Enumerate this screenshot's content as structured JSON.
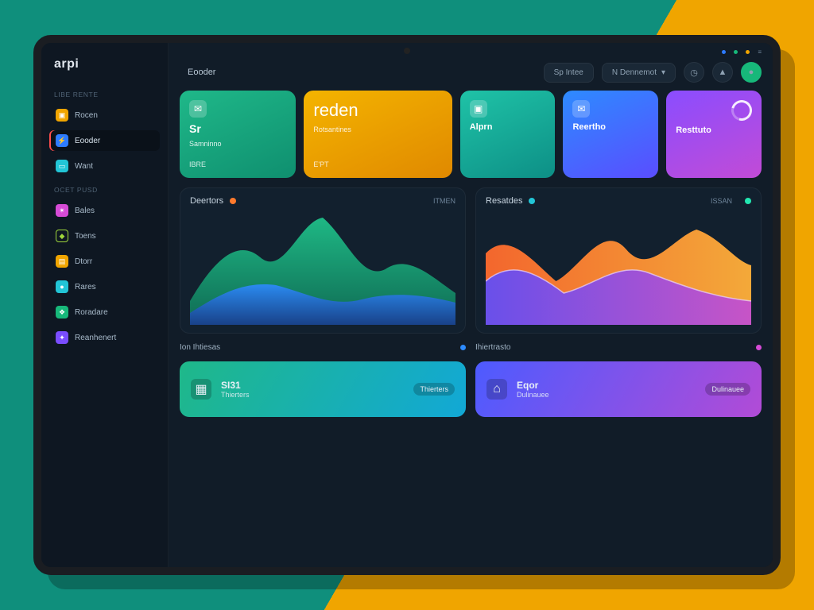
{
  "app": {
    "logo": "arpi"
  },
  "sidebar": {
    "groups": [
      {
        "label": "LIBE RENTE",
        "items": [
          {
            "label": "Rocen"
          },
          {
            "label": "Eooder",
            "active": true
          },
          {
            "label": "Want"
          }
        ]
      },
      {
        "label": "OCET  PUSD",
        "items": [
          {
            "label": "Bales"
          },
          {
            "label": "Toens"
          },
          {
            "label": "Dtorr"
          },
          {
            "label": "Rares"
          },
          {
            "label": "Roradare"
          },
          {
            "label": "Reanhenert"
          }
        ]
      }
    ]
  },
  "header": {
    "breadcrumb": "Eooder",
    "selector1": "Sp  Intee",
    "selector2": "N Dennemot",
    "status_dots": [
      "·",
      "·",
      "·"
    ]
  },
  "cards": [
    {
      "icon": "✉",
      "title": "Sr",
      "sub": "Samninno",
      "foot": "IBRE"
    },
    {
      "icon": "",
      "title": "reden",
      "sub": "Rotsantines",
      "foot": "E'PT"
    },
    {
      "icon": "📷",
      "title": "Alprn",
      "sub": "",
      "foot": ""
    },
    {
      "icon": "✉",
      "title": "Reertho",
      "sub": "",
      "foot": ""
    },
    {
      "icon": "◯",
      "title": "Resttuto",
      "sub": "",
      "foot": ""
    }
  ],
  "charts_meta": {
    "left": {
      "title": "Deertors",
      "sub": "ITMEN",
      "dot": "#ff7a2d"
    },
    "right": {
      "title": "Resatdes",
      "sub": "ISSAN",
      "dot": "#22c5d6"
    }
  },
  "chart_data": [
    {
      "type": "area",
      "title": "Deertors",
      "x": [
        0,
        1,
        2,
        3,
        4,
        5,
        6,
        7,
        8,
        9,
        10
      ],
      "series": [
        {
          "name": "green",
          "color": "#1fc089",
          "values": [
            20,
            55,
            70,
            48,
            72,
            92,
            58,
            40,
            60,
            45,
            30
          ]
        },
        {
          "name": "blue",
          "color": "#2d7bff",
          "values": [
            10,
            25,
            40,
            38,
            30,
            18,
            12,
            20,
            35,
            32,
            22
          ]
        }
      ],
      "ylim": [
        0,
        100
      ]
    },
    {
      "type": "area",
      "title": "Resatdes",
      "x": [
        0,
        1,
        2,
        3,
        4,
        5,
        6,
        7,
        8,
        9,
        10
      ],
      "series": [
        {
          "name": "orange",
          "color": "#ff8a2d",
          "values": [
            65,
            78,
            55,
            35,
            48,
            82,
            60,
            42,
            74,
            78,
            55
          ]
        },
        {
          "name": "violet",
          "color": "#7a4dff",
          "values": [
            40,
            55,
            48,
            30,
            22,
            38,
            55,
            44,
            30,
            26,
            20
          ]
        }
      ],
      "ylim": [
        0,
        100
      ]
    }
  ],
  "sections": {
    "left": {
      "title": "Ion Ihtiesas",
      "dot": "#2d8bff"
    },
    "right": {
      "title": "Ihiertrasto",
      "dot": "#d64bd6"
    }
  },
  "bottom": [
    {
      "icon": "🧰",
      "t1": "SI31",
      "t2": "Thierters",
      "tag": "Thierters"
    },
    {
      "icon": "🏛",
      "t1": "Eqor",
      "t2": "Dulinauee",
      "tag": "Dulinauee"
    }
  ]
}
